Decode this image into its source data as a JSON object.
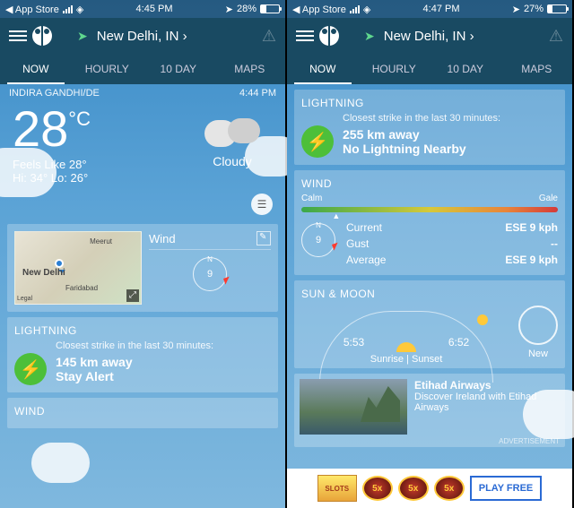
{
  "left": {
    "status": {
      "back": "App Store",
      "time": "4:45 PM",
      "battery": "28%",
      "batt_pct": 28
    },
    "location": "New Delhi, IN",
    "tabs": [
      "NOW",
      "HOURLY",
      "10 DAY",
      "MAPS"
    ],
    "header": {
      "station": "INDIRA GANDHI/DE",
      "updated": "4:44 PM"
    },
    "current": {
      "temp": "28",
      "unit": "°C",
      "feels": "Feels Like 28°",
      "hi": "Hi: 34°",
      "lo": "Lo: 26°",
      "condition": "Cloudy"
    },
    "map": {
      "meerut": "Meerut",
      "nd": "New Delhi",
      "fb": "Faridabad",
      "legal": "Legal",
      "wind_label": "Wind",
      "wind_val": "9"
    },
    "lightning": {
      "title": "LIGHTNING",
      "subtitle": "Closest strike in the last 30 minutes:",
      "distance": "145 km away",
      "status": "Stay Alert"
    },
    "wind_title": "WIND"
  },
  "right": {
    "status": {
      "back": "App Store",
      "time": "4:47 PM",
      "battery": "27%",
      "batt_pct": 27
    },
    "location": "New Delhi, IN",
    "tabs": [
      "NOW",
      "HOURLY",
      "10 DAY",
      "MAPS"
    ],
    "lightning": {
      "title": "LIGHTNING",
      "subtitle": "Closest strike in the last 30 minutes:",
      "distance": "255 km away",
      "status": "No Lightning Nearby"
    },
    "wind": {
      "title": "WIND",
      "calm": "Calm",
      "gale": "Gale",
      "compass": "9",
      "rows": [
        {
          "k": "Current",
          "v": "ESE 9 kph"
        },
        {
          "k": "Gust",
          "v": "--"
        },
        {
          "k": "Average",
          "v": "ESE 9 kph"
        }
      ]
    },
    "sun": {
      "title": "SUN & MOON",
      "sunrise": "5:53",
      "sunset": "6:52",
      "label": "Sunrise  |  Sunset",
      "moon": "New"
    },
    "ad": {
      "title": "Etihad Airways",
      "sub": "Discover Ireland with Etihad Airways",
      "tag": "ADVERTISEMENT"
    },
    "bottomad": {
      "logo": "SLOTS",
      "chip": "5x",
      "play": "PLAY FREE"
    }
  }
}
